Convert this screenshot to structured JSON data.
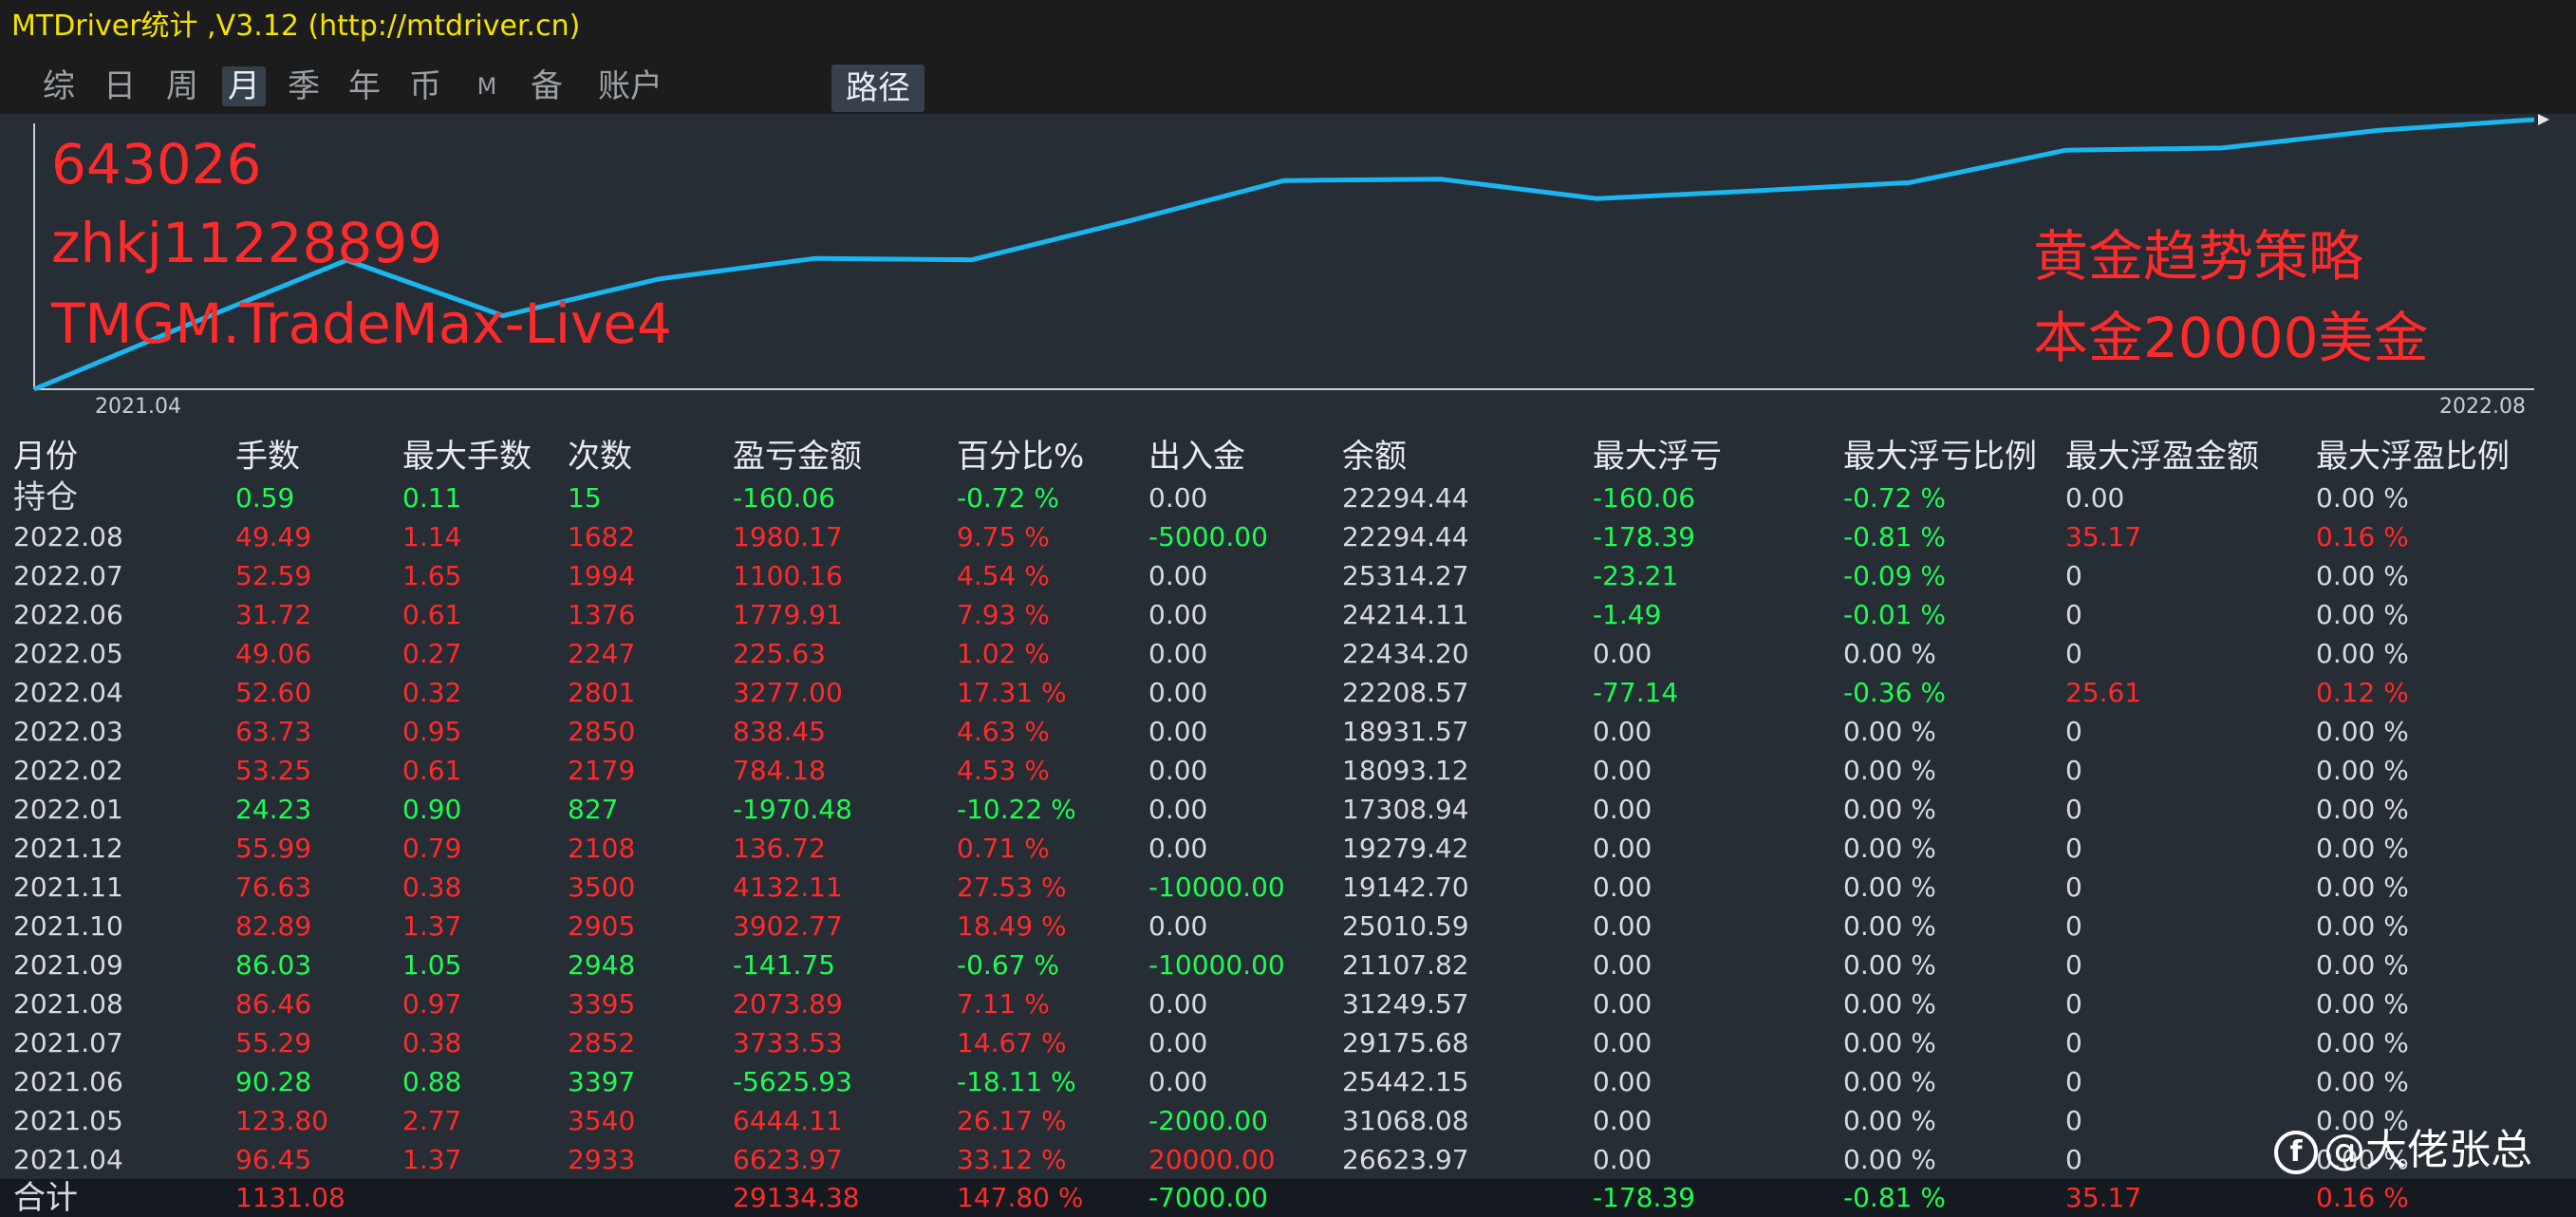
{
  "window": {
    "title": "MTDriver统计 ,V3.12 (http://mtdriver.cn)"
  },
  "tabs": [
    "综",
    "日",
    "周",
    "月",
    "季",
    "年",
    "币",
    "M",
    "备",
    "账户"
  ],
  "active_tab": "月",
  "path_tab": "路径",
  "chart": {
    "account": "643026",
    "user": "zhkj11228899",
    "server": "TMGM.TradeMax-Live4",
    "strategy": "黄金趋势策略",
    "capital": "本金20000美金",
    "x_start": "2021.04",
    "x_end": "2022.08",
    "line_color": "#19b6ef"
  },
  "chart_data": {
    "type": "line",
    "x": [
      "2021.04",
      "2021.05",
      "2021.06",
      "2021.07",
      "2021.08",
      "2021.09",
      "2021.10",
      "2021.11",
      "2021.12",
      "2022.01",
      "2022.02",
      "2022.03",
      "2022.04",
      "2022.05",
      "2022.06",
      "2022.07",
      "2022.08"
    ],
    "series": [
      {
        "values": [
          0,
          6623.97,
          13068.08,
          7442.15,
          11175.68,
          13249.57,
          13107.82,
          17010.59,
          21142.7,
          21279.42,
          19308.94,
          20093.12,
          20931.57,
          24208.57,
          24434.2,
          26214.11,
          27314.27
        ]
      }
    ]
  },
  "table": {
    "headers": [
      "月份",
      "手数",
      "最大手数",
      "次数",
      "盈亏金额",
      "百分比%",
      "出入金",
      "余额",
      "最大浮亏",
      "最大浮亏比例",
      "最大浮盈金额",
      "最大浮盈比例"
    ],
    "rows": [
      [
        "持仓",
        "0.59",
        "0.11",
        "15",
        "-160.06",
        "-0.72 %",
        "0.00",
        "22294.44",
        "-160.06",
        "-0.72 %",
        "0.00",
        "0.00 %"
      ],
      [
        "2022.08",
        "49.49",
        "1.14",
        "1682",
        "1980.17",
        "9.75 %",
        "-5000.00",
        "22294.44",
        "-178.39",
        "-0.81 %",
        "35.17",
        "0.16 %"
      ],
      [
        "2022.07",
        "52.59",
        "1.65",
        "1994",
        "1100.16",
        "4.54 %",
        "0.00",
        "25314.27",
        "-23.21",
        "-0.09 %",
        "0",
        "0.00 %"
      ],
      [
        "2022.06",
        "31.72",
        "0.61",
        "1376",
        "1779.91",
        "7.93 %",
        "0.00",
        "24214.11",
        "-1.49",
        "-0.01 %",
        "0",
        "0.00 %"
      ],
      [
        "2022.05",
        "49.06",
        "0.27",
        "2247",
        "225.63",
        "1.02 %",
        "0.00",
        "22434.20",
        "0.00",
        "0.00 %",
        "0",
        "0.00 %"
      ],
      [
        "2022.04",
        "52.60",
        "0.32",
        "2801",
        "3277.00",
        "17.31 %",
        "0.00",
        "22208.57",
        "-77.14",
        "-0.36 %",
        "25.61",
        "0.12 %"
      ],
      [
        "2022.03",
        "63.73",
        "0.95",
        "2850",
        "838.45",
        "4.63 %",
        "0.00",
        "18931.57",
        "0.00",
        "0.00 %",
        "0",
        "0.00 %"
      ],
      [
        "2022.02",
        "53.25",
        "0.61",
        "2179",
        "784.18",
        "4.53 %",
        "0.00",
        "18093.12",
        "0.00",
        "0.00 %",
        "0",
        "0.00 %"
      ],
      [
        "2022.01",
        "24.23",
        "0.90",
        "827",
        "-1970.48",
        "-10.22 %",
        "0.00",
        "17308.94",
        "0.00",
        "0.00 %",
        "0",
        "0.00 %"
      ],
      [
        "2021.12",
        "55.99",
        "0.79",
        "2108",
        "136.72",
        "0.71 %",
        "0.00",
        "19279.42",
        "0.00",
        "0.00 %",
        "0",
        "0.00 %"
      ],
      [
        "2021.11",
        "76.63",
        "0.38",
        "3500",
        "4132.11",
        "27.53 %",
        "-10000.00",
        "19142.70",
        "0.00",
        "0.00 %",
        "0",
        "0.00 %"
      ],
      [
        "2021.10",
        "82.89",
        "1.37",
        "2905",
        "3902.77",
        "18.49 %",
        "0.00",
        "25010.59",
        "0.00",
        "0.00 %",
        "0",
        "0.00 %"
      ],
      [
        "2021.09",
        "86.03",
        "1.05",
        "2948",
        "-141.75",
        "-0.67 %",
        "-10000.00",
        "21107.82",
        "0.00",
        "0.00 %",
        "0",
        "0.00 %"
      ],
      [
        "2021.08",
        "86.46",
        "0.97",
        "3395",
        "2073.89",
        "7.11 %",
        "0.00",
        "31249.57",
        "0.00",
        "0.00 %",
        "0",
        "0.00 %"
      ],
      [
        "2021.07",
        "55.29",
        "0.38",
        "2852",
        "3733.53",
        "14.67 %",
        "0.00",
        "29175.68",
        "0.00",
        "0.00 %",
        "0",
        "0.00 %"
      ],
      [
        "2021.06",
        "90.28",
        "0.88",
        "3397",
        "-5625.93",
        "-18.11 %",
        "0.00",
        "25442.15",
        "0.00",
        "0.00 %",
        "0",
        "0.00 %"
      ],
      [
        "2021.05",
        "123.80",
        "2.77",
        "3540",
        "6444.11",
        "26.17 %",
        "-2000.00",
        "31068.08",
        "0.00",
        "0.00 %",
        "0",
        "0.00 %"
      ],
      [
        "2021.04",
        "96.45",
        "1.37",
        "2933",
        "6623.97",
        "33.12 %",
        "20000.00",
        "26623.97",
        "0.00",
        "0.00 %",
        "0",
        "0.00 %"
      ]
    ],
    "total": [
      "合计",
      "1131.08",
      "",
      "",
      "29134.38",
      "147.80 %",
      "-7000.00",
      "",
      "-178.39",
      "-0.81 %",
      "35.17",
      "0.16 %"
    ]
  },
  "watermark": {
    "logo": "f",
    "text": "@大佬张总"
  }
}
